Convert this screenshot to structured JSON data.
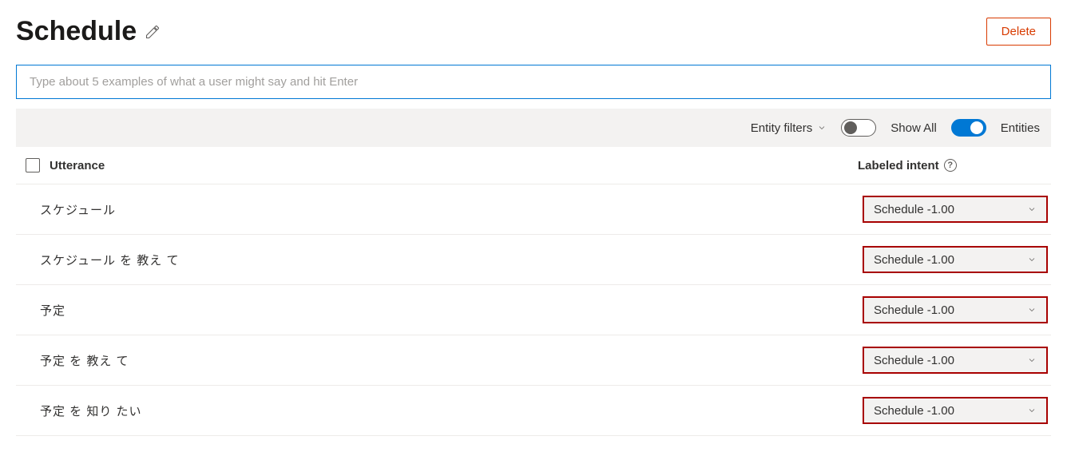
{
  "header": {
    "title": "Schedule",
    "delete_label": "Delete"
  },
  "input": {
    "placeholder": "Type about 5 examples of what a user might say and hit Enter"
  },
  "toolbar": {
    "entity_filters_label": "Entity filters",
    "show_all_label": "Show All",
    "entities_label": "Entities"
  },
  "columns": {
    "utterance": "Utterance",
    "labeled_intent": "Labeled intent",
    "help": "?"
  },
  "rows": [
    {
      "utterance": "スケジュール",
      "intent": "Schedule -1.00"
    },
    {
      "utterance": "スケジュール を 教え て",
      "intent": "Schedule -1.00"
    },
    {
      "utterance": "予定",
      "intent": "Schedule -1.00"
    },
    {
      "utterance": "予定 を 教え て",
      "intent": "Schedule -1.00"
    },
    {
      "utterance": "予定 を 知り たい",
      "intent": "Schedule -1.00"
    }
  ]
}
